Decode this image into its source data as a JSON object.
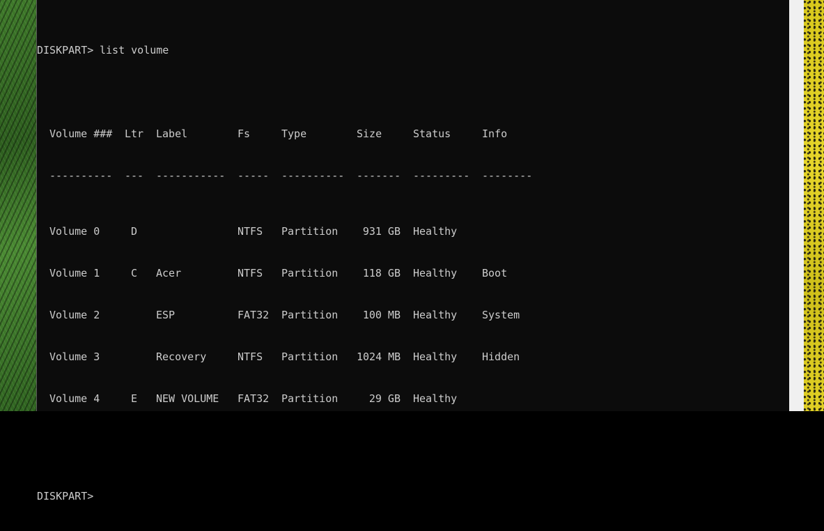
{
  "terminal": {
    "command_prompt": "DISKPART> ",
    "command": "list volume",
    "final_prompt": "DISKPART>",
    "headers": {
      "volume": "Volume ###",
      "ltr": "Ltr",
      "label": "Label",
      "fs": "Fs",
      "type": "Type",
      "size": "Size",
      "status": "Status",
      "info": "Info"
    },
    "separators": {
      "volume": "----------",
      "ltr": "---",
      "label": "-----------",
      "fs": "-----",
      "type": "----------",
      "size": "-------",
      "status": "---------",
      "info": "--------"
    },
    "rows": [
      {
        "volume": "Volume 0",
        "ltr": "D",
        "label": "",
        "fs": "NTFS",
        "type": "Partition",
        "size": "931 GB",
        "status": "Healthy",
        "info": ""
      },
      {
        "volume": "Volume 1",
        "ltr": "C",
        "label": "Acer",
        "fs": "NTFS",
        "type": "Partition",
        "size": "118 GB",
        "status": "Healthy",
        "info": "Boot"
      },
      {
        "volume": "Volume 2",
        "ltr": "",
        "label": "ESP",
        "fs": "FAT32",
        "type": "Partition",
        "size": "100 MB",
        "status": "Healthy",
        "info": "System"
      },
      {
        "volume": "Volume 3",
        "ltr": "",
        "label": "Recovery",
        "fs": "NTFS",
        "type": "Partition",
        "size": "1024 MB",
        "status": "Healthy",
        "info": "Hidden"
      },
      {
        "volume": "Volume 4",
        "ltr": "E",
        "label": "NEW VOLUME",
        "fs": "FAT32",
        "type": "Partition",
        "size": "29 GB",
        "status": "Healthy",
        "info": ""
      }
    ]
  },
  "colors": {
    "console_background": "#0c0c0c",
    "console_text": "#cccccc",
    "scrollbar_track": "#f0f0f0"
  }
}
